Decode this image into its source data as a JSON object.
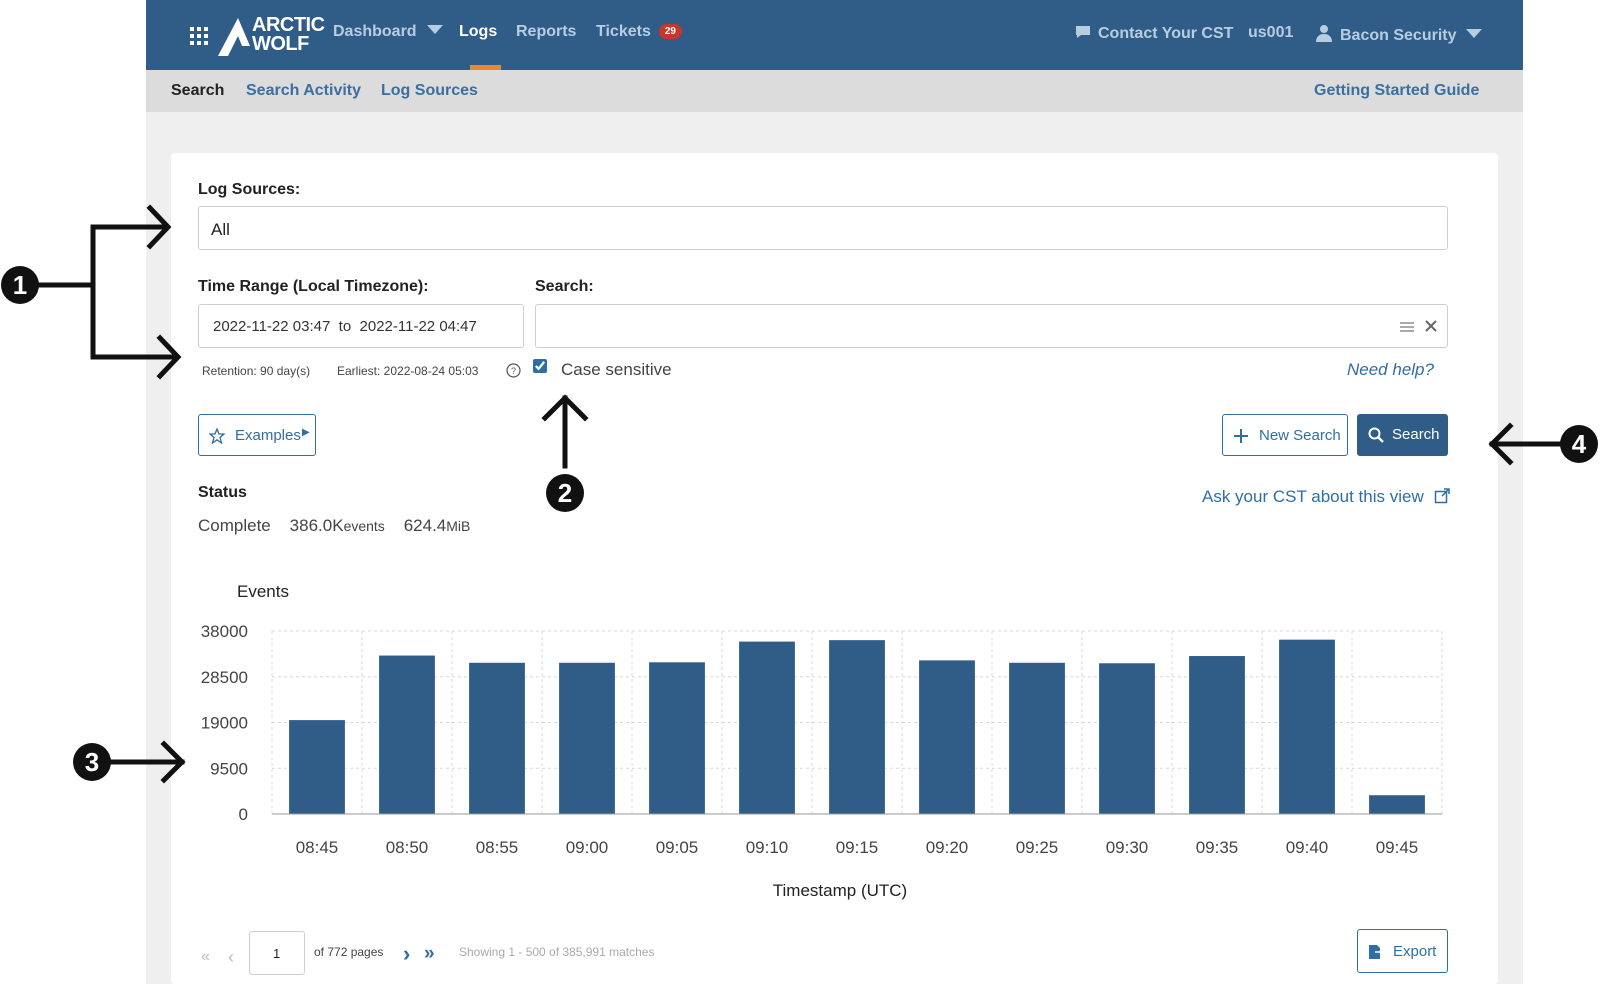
{
  "header": {
    "logo_line1": "ARCTIC",
    "logo_line2": "WOLF",
    "nav": [
      {
        "label": "Dashboard",
        "has_caret": true
      },
      {
        "label": "Logs",
        "active": true
      },
      {
        "label": "Reports"
      },
      {
        "label": "Tickets",
        "badge": "29"
      }
    ],
    "contact_label": "Contact Your CST",
    "region": "us001",
    "org": "Bacon Security",
    "accent_color": "#2f5d87"
  },
  "subnav": {
    "items": [
      "Search",
      "Search Activity",
      "Log Sources"
    ],
    "active": "Search",
    "guide_link": "Getting Started Guide"
  },
  "form": {
    "log_sources_label": "Log Sources:",
    "log_sources_value": "All",
    "time_range_label": "Time Range (Local Timezone):",
    "time_from": "2022-11-22 03:47",
    "time_to_word": "to",
    "time_to": "2022-11-22 04:47",
    "retention": "Retention: 90 day(s)",
    "earliest": "Earliest: 2022-08-24 05:03",
    "search_label": "Search:",
    "search_value": "",
    "case_sensitive_label": "Case sensitive",
    "case_sensitive_checked": true,
    "need_help": "Need help?",
    "examples_button": "Examples",
    "new_search_button": "New Search",
    "search_button": "Search"
  },
  "status": {
    "label": "Status",
    "state": "Complete",
    "events_value": "386.0K",
    "events_unit": "events",
    "size_value": "624.4",
    "size_unit": "MiB",
    "ask_cst": "Ask your CST about this view"
  },
  "chart_data": {
    "type": "bar",
    "ylabel": "Events",
    "xlabel": "Timestamp (UTC)",
    "categories": [
      "08:45",
      "08:50",
      "08:55",
      "09:00",
      "09:05",
      "09:10",
      "09:15",
      "09:20",
      "09:25",
      "09:30",
      "09:35",
      "09:40",
      "09:45"
    ],
    "values": [
      19500,
      32900,
      31400,
      31400,
      31500,
      35800,
      36100,
      31900,
      31400,
      31300,
      32800,
      36200,
      3900
    ],
    "yticks": [
      0,
      9500,
      19000,
      28500,
      38000
    ],
    "ylim": [
      0,
      38000
    ],
    "bar_color": "#2f5d87",
    "grid": true
  },
  "pager": {
    "first": "«",
    "prev": "‹",
    "page": "1",
    "of_pages": "of 772 pages",
    "next": "›",
    "last": "»",
    "showing": "Showing 1 - 500 of 385,991 matches",
    "export": "Export"
  },
  "annotations": [
    "1",
    "2",
    "3",
    "4"
  ]
}
